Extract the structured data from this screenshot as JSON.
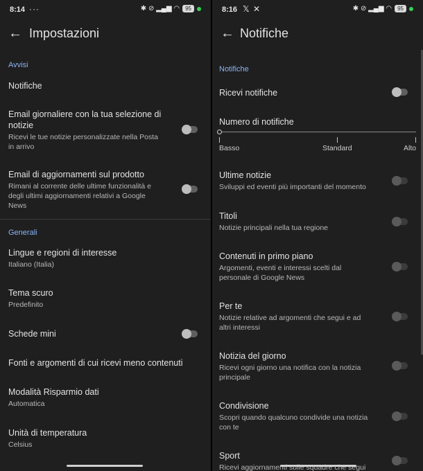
{
  "left": {
    "status": {
      "time": "8:14",
      "extra": "···",
      "battery": "95"
    },
    "title": "Impostazioni",
    "sections": {
      "avvisi": "Avvisi",
      "generali": "Generali"
    },
    "rows": {
      "notifiche": {
        "title": "Notifiche"
      },
      "email_giornaliere": {
        "title": "Email giornaliere con la tua selezione di notizie",
        "subtitle": "Ricevi le tue notizie personalizzate nella Posta in arrivo"
      },
      "email_aggiornamenti": {
        "title": "Email di aggiornamenti sul prodotto",
        "subtitle": "Rimani al corrente delle ultime funzionalità e degli ultimi aggiornamenti relativi a Google News"
      },
      "lingue": {
        "title": "Lingue e regioni di interesse",
        "subtitle": "Italiano (Italia)"
      },
      "tema": {
        "title": "Tema scuro",
        "subtitle": "Predefinito"
      },
      "schede": {
        "title": "Schede mini"
      },
      "fonti": {
        "title": "Fonti e argomenti di cui ricevi meno contenuti"
      },
      "risparmio": {
        "title": "Modalità Risparmio dati",
        "subtitle": "Automatica"
      },
      "temperatura": {
        "title": "Unità di temperatura",
        "subtitle": "Celsius"
      }
    }
  },
  "right": {
    "status": {
      "time": "8:16",
      "extra": "𝕏  ✕",
      "battery": "95"
    },
    "title": "Notifiche",
    "section": "Notifiche",
    "ricevi": {
      "title": "Ricevi notifiche"
    },
    "numero": {
      "title": "Numero di notifiche",
      "labels": {
        "basso": "Basso",
        "standard": "Standard",
        "alto": "Alto"
      }
    },
    "rows": {
      "ultime": {
        "title": "Ultime notizie",
        "subtitle": "Sviluppi ed eventi più importanti del momento"
      },
      "titoli": {
        "title": "Titoli",
        "subtitle": "Notizie principali nella tua regione"
      },
      "contenuti": {
        "title": "Contenuti in primo piano",
        "subtitle": "Argomenti, eventi e interessi scelti dal personale di Google News"
      },
      "perte": {
        "title": "Per te",
        "subtitle": "Notizie relative ad argomenti che segui e ad altri interessi"
      },
      "giorno": {
        "title": "Notizia del giorno",
        "subtitle": "Ricevi ogni giorno una notifica con la notizia principale"
      },
      "condivisione": {
        "title": "Condivisione",
        "subtitle": "Scopri quando qualcuno condivide una notizia con te"
      },
      "sport": {
        "title": "Sport",
        "subtitle": "Ricevi aggiornamenti sulle squadre che segui"
      }
    }
  },
  "icons": {
    "back": "←",
    "status_icons": "✱ ⊘ ▂▄▆ ◠"
  }
}
